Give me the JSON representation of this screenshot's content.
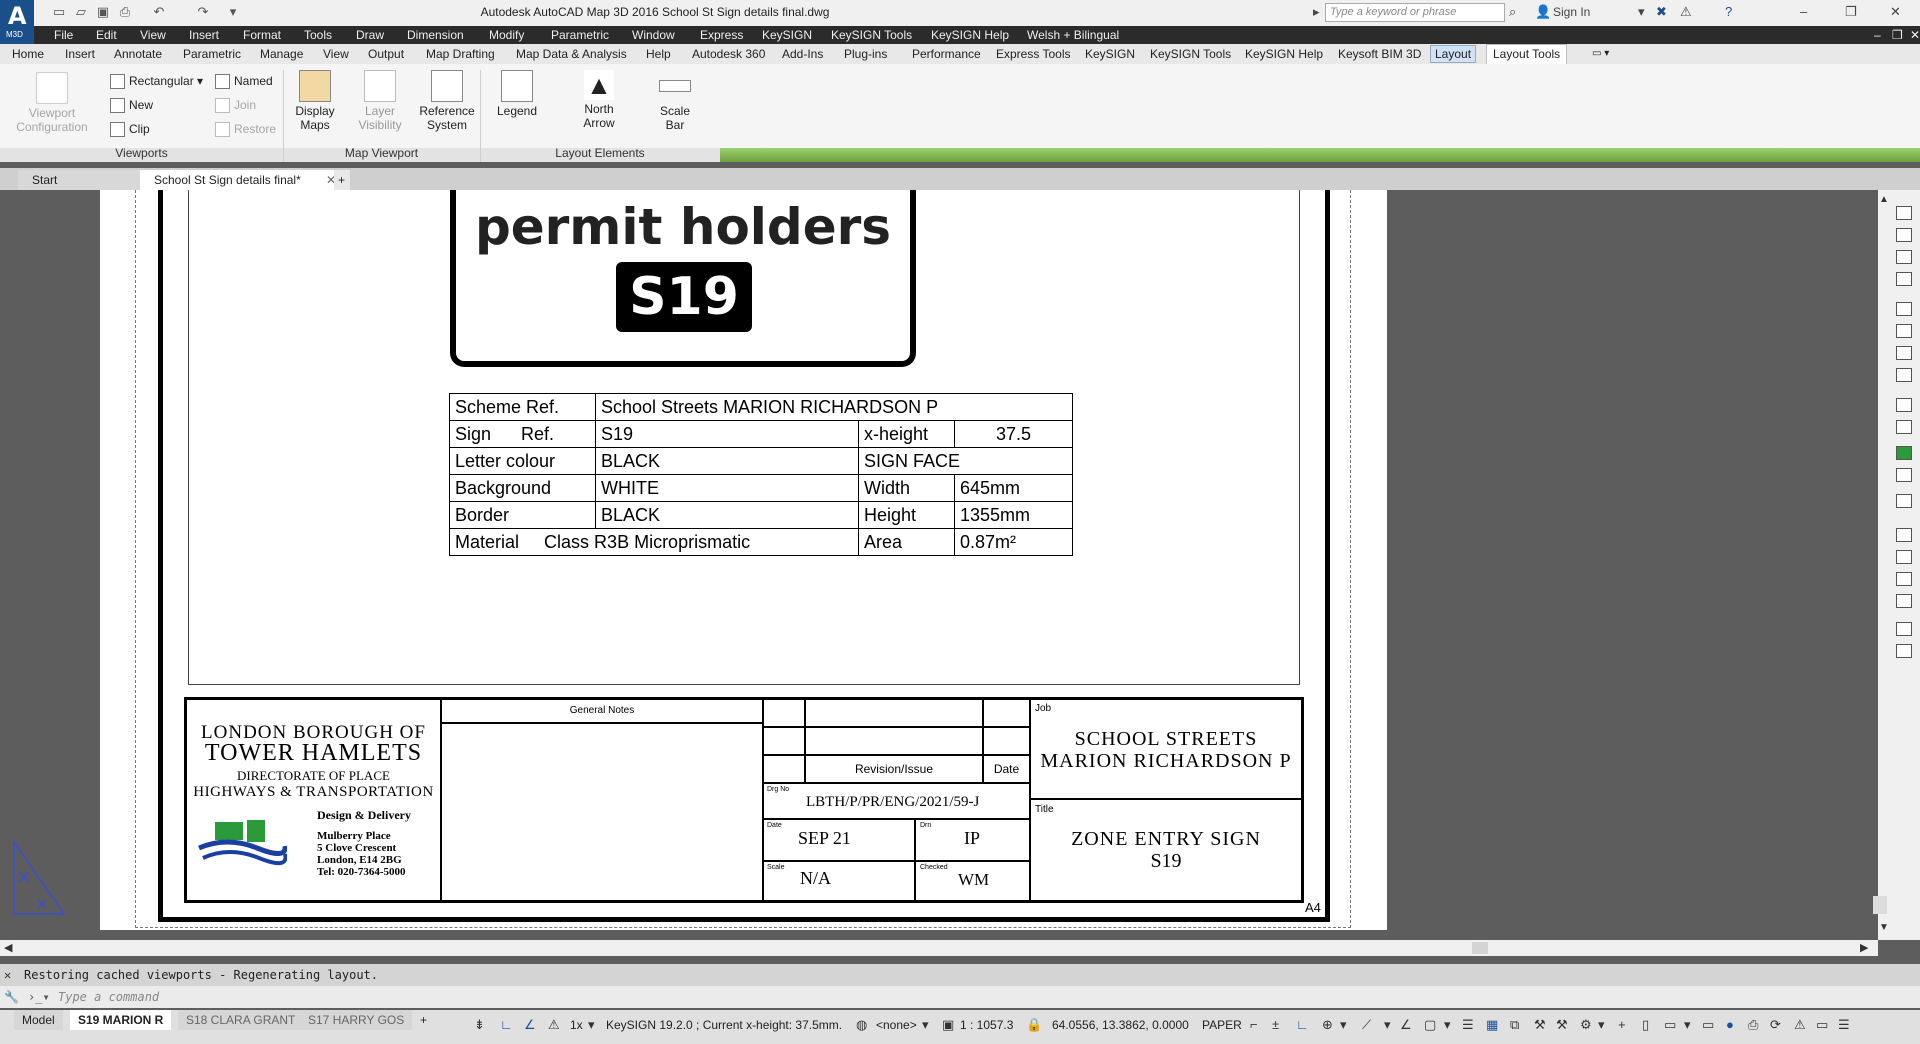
{
  "window": {
    "title": "Autodesk AutoCAD Map 3D 2016    School St Sign details final.dwg",
    "logo_text": "A",
    "logo_sub": "M3D",
    "search_placeholder": "Type a keyword or phrase",
    "sign_in": "Sign In"
  },
  "menubar": [
    "File",
    "Edit",
    "View",
    "Insert",
    "Format",
    "Tools",
    "Draw",
    "Dimension",
    "Modify",
    "Parametric",
    "Window",
    "Express",
    "KeySIGN",
    "KeySIGN Tools",
    "KeySIGN Help",
    "Welsh + Bilingual"
  ],
  "ribbon_tabs": [
    "Home",
    "Insert",
    "Annotate",
    "Parametric",
    "Manage",
    "View",
    "Output",
    "Map Drafting",
    "Map Data & Analysis",
    "Help",
    "Autodesk 360",
    "Add-Ins",
    "Plug-ins",
    "Performance",
    "Express Tools",
    "KeySIGN",
    "KeySIGN Tools",
    "KeySIGN Help",
    "Keysoft BIM 3D",
    "Layout",
    "Layout Tools"
  ],
  "ribbon": {
    "viewport_config": [
      "Viewport",
      "Configuration"
    ],
    "rectangular": "Rectangular",
    "new": "New",
    "clip": "Clip",
    "named": "Named",
    "join": "Join",
    "restore": "Restore",
    "display_maps": [
      "Display",
      "Maps"
    ],
    "layer_visibility": [
      "Layer",
      "Visibility"
    ],
    "reference_system": [
      "Reference",
      "System"
    ],
    "legend": "Legend",
    "north_arrow": [
      "North",
      "Arrow"
    ],
    "scale_bar": [
      "Scale",
      "Bar"
    ],
    "panels": [
      "Viewports",
      "Map Viewport",
      "Layout Elements"
    ]
  },
  "doc_tabs": {
    "start": "Start",
    "file": "School St Sign details final*"
  },
  "drawing": {
    "sign_text": "permit holders",
    "sign_code": "S19",
    "spec": {
      "scheme_ref_label": "Scheme Ref.",
      "scheme_ref_value": "School Streets MARION RICHARDSON P",
      "rows": [
        {
          "label": "Sign      Ref.",
          "value": "S19",
          "rlabel": "x-height",
          "rvalue": "37.5"
        },
        {
          "label": "Letter colour",
          "value": "BLACK",
          "rlabel": "SIGN FACE",
          "rvalue": ""
        },
        {
          "label": "Background",
          "value": "WHITE",
          "rlabel": "Width",
          "rvalue": "645mm"
        },
        {
          "label": "Border",
          "value": "BLACK",
          "rlabel": "Height",
          "rvalue": "1355mm"
        }
      ],
      "material_label": "Material",
      "material_value": "Class R3B Microprismatic",
      "area_label": "Area",
      "area_value": "0.87m²"
    },
    "title_block": {
      "org1": "LONDON BOROUGH OF",
      "org2": "TOWER HAMLETS",
      "org3": "DIRECTORATE OF PLACE",
      "org4": "HIGHWAYS & TRANSPORTATION",
      "org5": "Design & Delivery",
      "addr1": "Mulberry Place",
      "addr2": "5 Clove Crescent",
      "addr3": "London, E14 2BG",
      "addr4": "Tel: 020-7364-5000",
      "general_notes": "General Notes",
      "revision": "Revision/Issue",
      "date_hdr": "Date",
      "drg_no_lbl": "Drg No",
      "drg_no": "LBTH/P/PR/ENG/2021/59-J",
      "date_lbl": "Date",
      "date": "SEP 21",
      "drn_lbl": "Drn",
      "drn": "IP",
      "scale_lbl": "Scale",
      "scale": "N/A",
      "checked_lbl": "Checked",
      "checked": "WM",
      "job_lbl": "Job",
      "job1": "SCHOOL STREETS",
      "job2": "MARION RICHARDSON P",
      "title_lbl": "Title",
      "title1": "ZONE ENTRY SIGN",
      "title2": "S19",
      "sheet_size": "A4"
    }
  },
  "command": {
    "history": "Restoring cached viewports - Regenerating layout.",
    "placeholder": "Type a command"
  },
  "layout_tabs": [
    "Model",
    "S19 MARION R",
    "S18 CLARA GRANT",
    "S17 HARRY GOS"
  ],
  "status": {
    "scale_factor": "1x",
    "keysign": "KeySIGN  19.2.0 ;  Current x-height: 37.5mm.",
    "none": "<none>",
    "scale": "1 : 1057.3",
    "coords": "64.0556, 13.3862, 0.0000",
    "space": "PAPER"
  }
}
